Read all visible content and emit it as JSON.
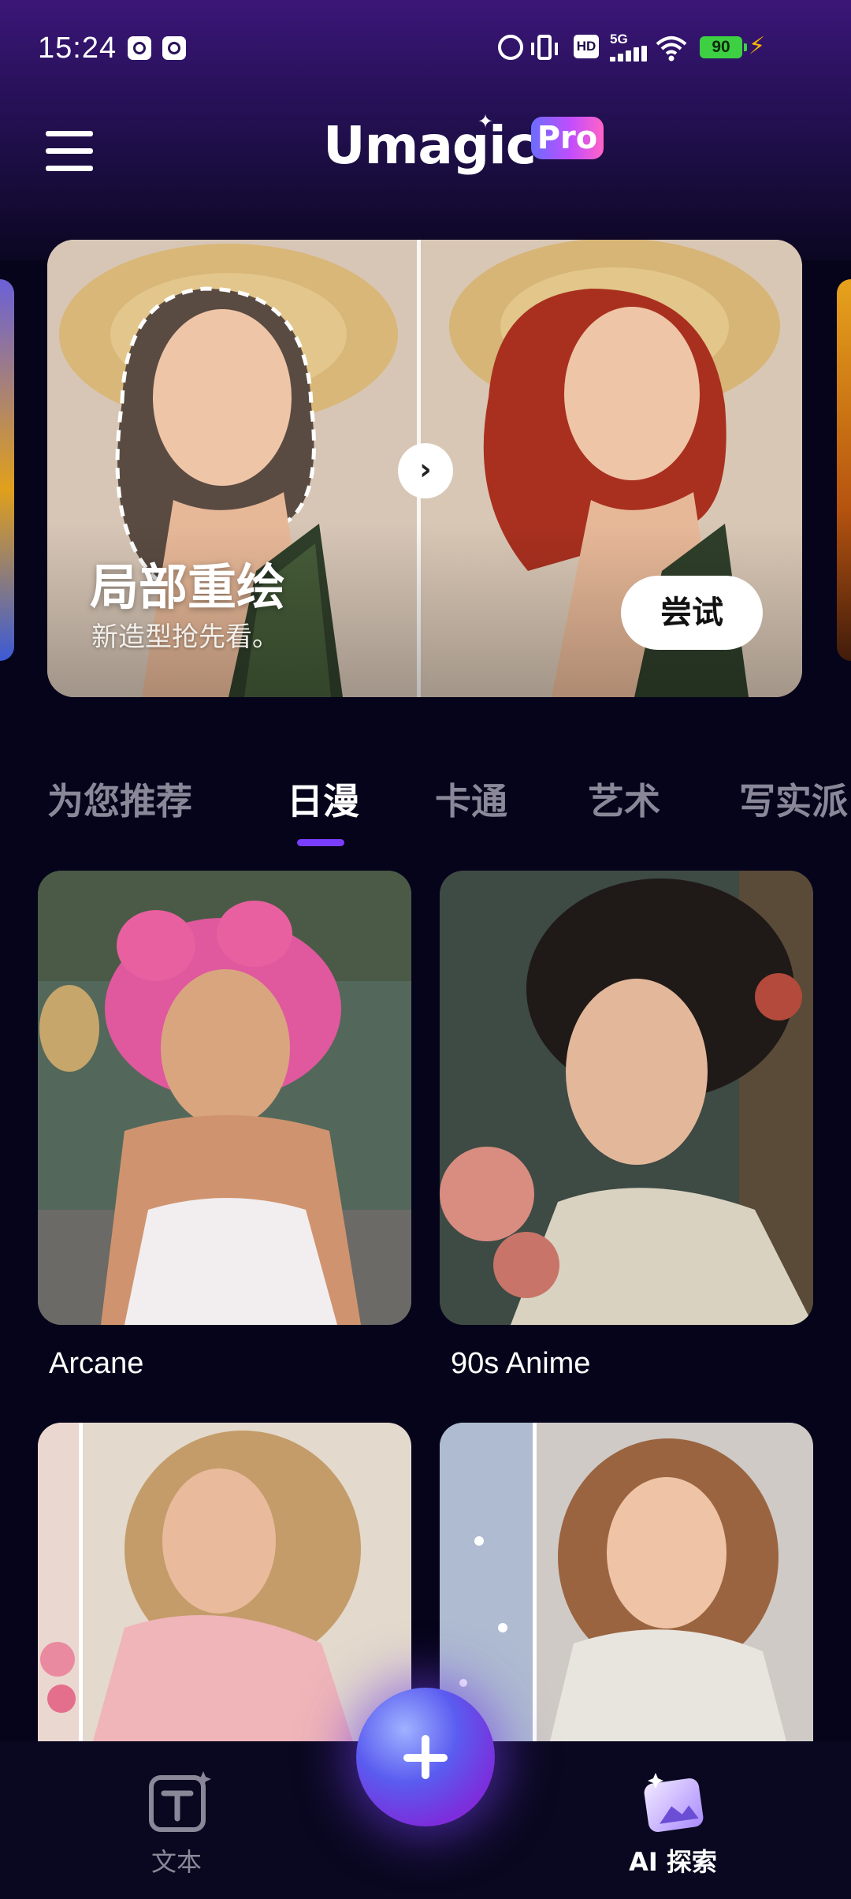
{
  "status_bar": {
    "time": "15:24",
    "network": "5G",
    "hd_label": "HD",
    "battery": "90"
  },
  "header": {
    "logo_text": "Umagic",
    "logo_badge": "Pro",
    "menu_icon": "hamburger-menu-icon"
  },
  "banner": {
    "title": "局部重绘",
    "subtitle": "新造型抢先看。",
    "try_label": "尝试"
  },
  "tabs": [
    {
      "label": "为您推荐",
      "active": false
    },
    {
      "label": "日漫",
      "active": true
    },
    {
      "label": "卡通",
      "active": false
    },
    {
      "label": "艺术",
      "active": false
    },
    {
      "label": "写实派",
      "active": false
    }
  ],
  "styles_grid": [
    {
      "label": "Arcane"
    },
    {
      "label": "90s Anime"
    },
    {
      "label": ""
    },
    {
      "label": ""
    }
  ],
  "bottom_nav": {
    "text_label": "文本",
    "explore_label": "AI 探索",
    "fab_icon": "plus-icon"
  },
  "colors": {
    "background": "#06041a",
    "accent": "#7a3cff",
    "tab_inactive": "#8a8799"
  }
}
